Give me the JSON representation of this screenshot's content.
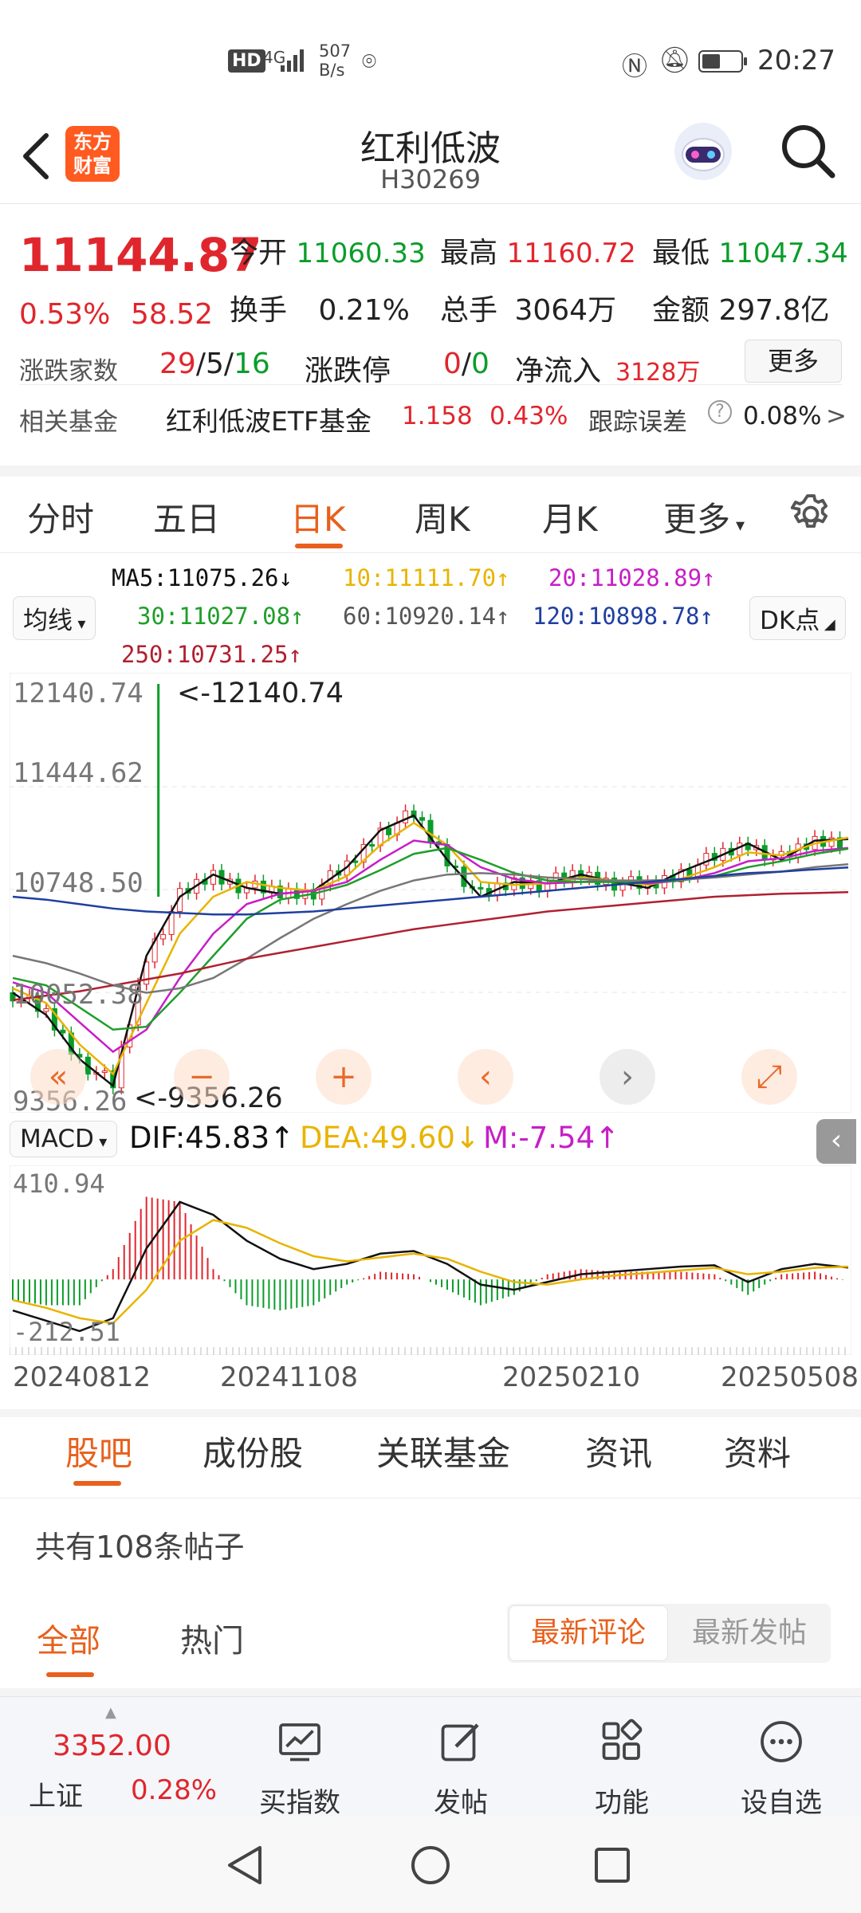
{
  "status_bar": {
    "hd": "HD",
    "net": "4G",
    "speed_top": "507",
    "speed_bottom": "B/s",
    "time": "20:27"
  },
  "header": {
    "back_icon": "back-arrow-icon",
    "app_logo_line1": "东方",
    "app_logo_line2": "财富",
    "title": "红利低波",
    "code": "H30269",
    "search_icon": "search-icon"
  },
  "quote": {
    "price": "11144.87",
    "change_pct": "0.53%",
    "change": "58.52",
    "open_label": "今开",
    "open": "11060.33",
    "high_label": "最高",
    "high": "11160.72",
    "low_label": "最低",
    "low": "11047.34",
    "turnover_label": "换手",
    "turnover": "0.21%",
    "volume_label": "总手",
    "volume": "3064万",
    "amount_label": "金额",
    "amount": "297.8亿",
    "updown_label": "涨跌家数",
    "up_count": "29",
    "flat_count": "5",
    "down_count": "16",
    "limit_label": "涨跌停",
    "limit_up": "0",
    "limit_down": "0",
    "netflow_label": "净流入",
    "netflow": "3128万",
    "more_button": "更多"
  },
  "fund": {
    "label": "相关基金",
    "name": "红利低波ETF基金",
    "price": "1.158",
    "pct": "0.43%",
    "tracking_label": "跟踪误差",
    "tracking_value": "0.08%",
    "chevron": ">"
  },
  "period_tabs": [
    "分时",
    "五日",
    "日K",
    "周K",
    "月K",
    "更多"
  ],
  "active_period": "日K",
  "ma_legend": {
    "selector": "均线",
    "ma5": "MA5:11075.26↓",
    "ma10": "10:11111.70↑",
    "ma20": "20:11028.89↑",
    "ma30": "30:11027.08↑",
    "ma60": "60:10920.14↑",
    "ma120": "120:10898.78↑",
    "ma250": "250:10731.25↑",
    "dk_button": "DK点"
  },
  "colors": {
    "up": "#e0262d",
    "down": "#0a9d2a",
    "accent": "#e8601c",
    "ma5": "#111111",
    "ma10": "#e8b400",
    "ma20": "#c71ec7",
    "ma30": "#1f9e2a",
    "ma60": "#777777",
    "ma120": "#1f3fa0",
    "ma250": "#b02030"
  },
  "chart_data": {
    "type": "candlestick",
    "y_ticks": [
      "12140.74",
      "11444.62",
      "10748.50",
      "10052.38",
      "9356.26"
    ],
    "high_marker": "<-12140.74",
    "low_marker": "<-9356.26",
    "ylim": [
      9356.26,
      12140.74
    ],
    "x_ticks": [
      "20240812",
      "20241108",
      "20250210",
      "20250508"
    ],
    "series": [
      {
        "name": "MA5",
        "values": [
          10050,
          9900,
          9600,
          9420,
          10300,
          10700,
          10850,
          10760,
          10720,
          10740,
          10900,
          11150,
          11250,
          10950,
          10700,
          10800,
          10790,
          10850,
          10800,
          10760,
          10870,
          10960,
          11060,
          10950,
          11080,
          11090
        ]
      },
      {
        "name": "MA10",
        "values": [
          10080,
          9980,
          9700,
          9500,
          9980,
          10450,
          10700,
          10800,
          10760,
          10740,
          10840,
          11050,
          11200,
          11050,
          10800,
          10780,
          10790,
          10830,
          10810,
          10780,
          10820,
          10900,
          11000,
          10980,
          11060,
          11100
        ]
      },
      {
        "name": "MA20",
        "values": [
          10120,
          10050,
          9850,
          9650,
          9800,
          10150,
          10450,
          10650,
          10720,
          10740,
          10800,
          10950,
          11080,
          11050,
          10900,
          10820,
          10790,
          10800,
          10810,
          10790,
          10810,
          10860,
          10940,
          10960,
          11010,
          11030
        ]
      },
      {
        "name": "MA30",
        "values": [
          10150,
          10100,
          9950,
          9800,
          9820,
          10050,
          10300,
          10550,
          10680,
          10720,
          10780,
          10880,
          10990,
          11030,
          10950,
          10860,
          10810,
          10800,
          10800,
          10800,
          10810,
          10840,
          10900,
          10940,
          10990,
          11025
        ]
      },
      {
        "name": "MA60",
        "values": [
          10300,
          10250,
          10180,
          10100,
          10050,
          10080,
          10150,
          10280,
          10420,
          10550,
          10650,
          10740,
          10810,
          10850,
          10860,
          10850,
          10830,
          10820,
          10810,
          10810,
          10815,
          10830,
          10850,
          10870,
          10900,
          10920
        ]
      },
      {
        "name": "MA120",
        "values": [
          10700,
          10680,
          10650,
          10620,
          10600,
          10590,
          10580,
          10580,
          10590,
          10600,
          10620,
          10640,
          10660,
          10680,
          10700,
          10720,
          10740,
          10760,
          10780,
          10800,
          10820,
          10840,
          10860,
          10870,
          10885,
          10898
        ]
      },
      {
        "name": "MA250",
        "values": [
          10000,
          10030,
          10060,
          10100,
          10140,
          10180,
          10230,
          10280,
          10320,
          10360,
          10400,
          10440,
          10480,
          10510,
          10540,
          10570,
          10600,
          10620,
          10640,
          10660,
          10680,
          10700,
          10710,
          10720,
          10725,
          10731
        ]
      }
    ]
  },
  "macd": {
    "selector": "MACD",
    "dif": "DIF:45.83↑",
    "dea": "DEA:49.60↓",
    "m": "M:-7.54↑",
    "y_top": "410.94",
    "y_bottom": "-212.51",
    "dif_values": [
      -120,
      -160,
      -200,
      -150,
      120,
      300,
      250,
      150,
      80,
      40,
      60,
      100,
      110,
      60,
      -20,
      -40,
      -10,
      20,
      30,
      40,
      50,
      55,
      -10,
      40,
      60,
      46
    ],
    "dea_values": [
      -80,
      -110,
      -150,
      -170,
      -40,
      150,
      230,
      200,
      140,
      90,
      70,
      85,
      100,
      80,
      30,
      -10,
      -20,
      0,
      15,
      25,
      35,
      45,
      20,
      30,
      45,
      50
    ]
  },
  "chart_controls": [
    "«",
    "−",
    "+",
    "‹",
    "›",
    "⤢"
  ],
  "bottom_tabs": [
    "股吧",
    "成份股",
    "关联基金",
    "资讯",
    "资料"
  ],
  "active_bottom_tab": "股吧",
  "posts": {
    "count_text": "共有108条帖子",
    "filter_all": "全部",
    "filter_hot": "热门",
    "sort_latest_comment": "最新评论",
    "sort_latest_post": "最新发帖"
  },
  "bottom_bar": {
    "index_value": "3352.00",
    "index_name": "上证",
    "index_pct": "0.28%",
    "buy_index": "买指数",
    "post": "发帖",
    "functions": "功能",
    "watchlist": "设自选"
  }
}
